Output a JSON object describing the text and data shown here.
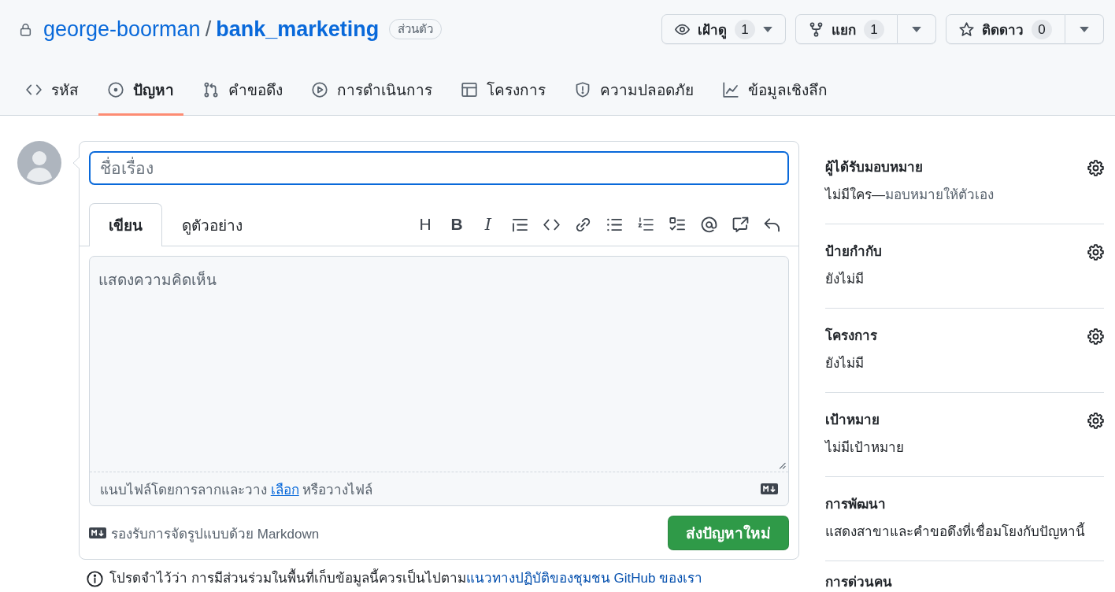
{
  "repo": {
    "owner": "george-boorman",
    "separator": "/",
    "name": "bank_marketing",
    "visibility": "ส่วนตัว"
  },
  "actions": [
    {
      "label": "เฝ้าดู",
      "count": "1",
      "kind": "dropdown"
    },
    {
      "label": "แยก",
      "count": "1",
      "kind": "split"
    },
    {
      "label": "ติดดาว",
      "count": "0",
      "kind": "split"
    }
  ],
  "tabs": [
    {
      "label": "รหัส",
      "selected": false
    },
    {
      "label": "ปัญหา",
      "selected": true
    },
    {
      "label": "คำขอดึง",
      "selected": false
    },
    {
      "label": "การดำเนินการ",
      "selected": false
    },
    {
      "label": "โครงการ",
      "selected": false
    },
    {
      "label": "ความปลอดภัย",
      "selected": false
    },
    {
      "label": "ข้อมูลเชิงลึก",
      "selected": false
    }
  ],
  "issue_form": {
    "title_placeholder": "ชื่อเรื่อง",
    "editor_tabs": [
      {
        "label": "เขียน",
        "selected": true
      },
      {
        "label": "ดูตัวอย่าง",
        "selected": false
      }
    ],
    "toolbar_glyphs": [
      "H",
      "B",
      "I"
    ],
    "comment_placeholder": "แสดงความคิดเห็น",
    "attach": {
      "before": "แนบไฟล์โดยการลากและวาง",
      "link": "เลือก",
      "after": "หรือวางไฟล์"
    },
    "markdown_note": "รองรับการจัดรูปแบบด้วย Markdown",
    "submit": "ส่งปัญหาใหม่"
  },
  "guidelines": {
    "text": "โปรดจำไว้ว่า การมีส่วนร่วมในพื้นที่เก็บข้อมูลนี้ควรเป็นไปตาม",
    "link": "แนวทางปฏิบัติของชุมชน GitHub ของเรา"
  },
  "sidebar": [
    {
      "heading": "ผู้ได้รับมอบหมาย",
      "editable": true,
      "value": "ไม่มีใคร—",
      "link": "มอบหมายให้ตัวเอง"
    },
    {
      "heading": "ป้ายกำกับ",
      "editable": true,
      "value": "ยังไม่มี"
    },
    {
      "heading": "โครงการ",
      "editable": true,
      "value": "ยังไม่มี"
    },
    {
      "heading": "เป้าหมาย",
      "editable": true,
      "value": "ไม่มีเป้าหมาย"
    },
    {
      "heading": "การพัฒนา",
      "editable": false,
      "value": "แสดงสาขาและคำขอดึงที่เชื่อมโยงกับปัญหานี้"
    },
    {
      "heading": "การด่วนคน",
      "editable": false
    }
  ]
}
